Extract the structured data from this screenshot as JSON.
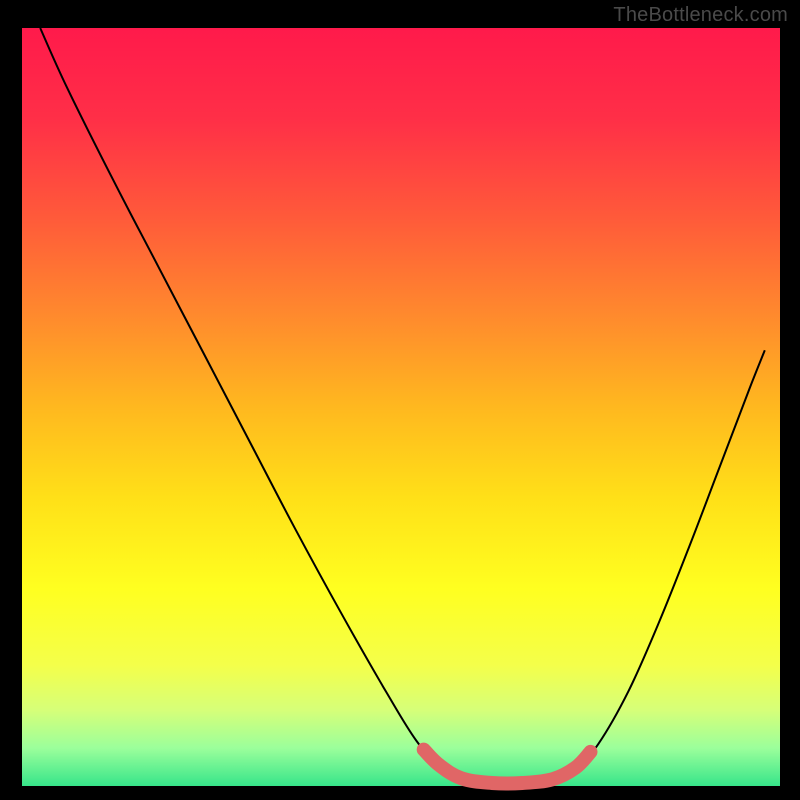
{
  "watermark": "TheBottleneck.com",
  "chart_data": {
    "type": "line",
    "title": "",
    "xlabel": "",
    "ylabel": "",
    "xlim": [
      0,
      100
    ],
    "ylim": [
      0,
      100
    ],
    "grid": false,
    "legend": false,
    "background_gradient": {
      "stops": [
        {
          "offset": 0.0,
          "color": "#ff1a4b"
        },
        {
          "offset": 0.12,
          "color": "#ff2f47"
        },
        {
          "offset": 0.25,
          "color": "#ff5a3a"
        },
        {
          "offset": 0.38,
          "color": "#ff8a2d"
        },
        {
          "offset": 0.5,
          "color": "#ffb81f"
        },
        {
          "offset": 0.62,
          "color": "#ffe018"
        },
        {
          "offset": 0.74,
          "color": "#ffff20"
        },
        {
          "offset": 0.84,
          "color": "#f4ff4a"
        },
        {
          "offset": 0.9,
          "color": "#d6ff79"
        },
        {
          "offset": 0.95,
          "color": "#9bff9b"
        },
        {
          "offset": 1.0,
          "color": "#37e58a"
        }
      ]
    },
    "series": [
      {
        "name": "bottleneck-curve",
        "stroke": "#000000",
        "stroke_width": 2,
        "points": [
          {
            "x": 2.4,
            "y": 100.0
          },
          {
            "x": 6.0,
            "y": 92.0
          },
          {
            "x": 12.0,
            "y": 80.0
          },
          {
            "x": 18.0,
            "y": 68.5
          },
          {
            "x": 24.0,
            "y": 57.0
          },
          {
            "x": 30.0,
            "y": 45.5
          },
          {
            "x": 36.0,
            "y": 34.0
          },
          {
            "x": 42.0,
            "y": 23.0
          },
          {
            "x": 48.0,
            "y": 12.5
          },
          {
            "x": 52.0,
            "y": 6.0
          },
          {
            "x": 55.0,
            "y": 2.8
          },
          {
            "x": 58.0,
            "y": 1.0
          },
          {
            "x": 62.0,
            "y": 0.3
          },
          {
            "x": 66.0,
            "y": 0.3
          },
          {
            "x": 70.0,
            "y": 0.8
          },
          {
            "x": 73.0,
            "y": 2.2
          },
          {
            "x": 76.0,
            "y": 5.5
          },
          {
            "x": 80.0,
            "y": 12.5
          },
          {
            "x": 84.0,
            "y": 21.5
          },
          {
            "x": 88.0,
            "y": 31.5
          },
          {
            "x": 92.0,
            "y": 42.0
          },
          {
            "x": 96.0,
            "y": 52.5
          },
          {
            "x": 98.0,
            "y": 57.5
          }
        ]
      }
    ],
    "overlay": {
      "name": "highlight-valley",
      "stroke": "#e06666",
      "stroke_width": 14,
      "points": [
        {
          "x": 53.0,
          "y": 4.8
        },
        {
          "x": 55.0,
          "y": 2.8
        },
        {
          "x": 58.0,
          "y": 1.0
        },
        {
          "x": 62.0,
          "y": 0.4
        },
        {
          "x": 66.0,
          "y": 0.4
        },
        {
          "x": 70.0,
          "y": 0.9
        },
        {
          "x": 73.0,
          "y": 2.4
        },
        {
          "x": 75.0,
          "y": 4.5
        }
      ]
    }
  }
}
